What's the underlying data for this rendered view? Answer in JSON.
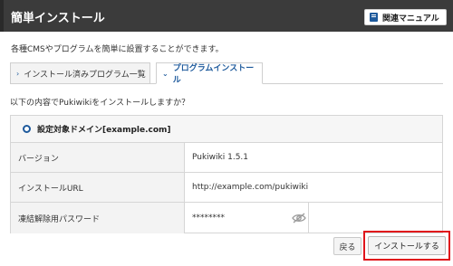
{
  "header": {
    "title": "簡単インストール",
    "manual_label": "関連マニュアル"
  },
  "description": "各種CMSやプログラムを簡単に設置することができます。",
  "tabs": [
    {
      "label": "インストール済みプログラム一覧",
      "active": false
    },
    {
      "label": "プログラムインストール",
      "active": true
    }
  ],
  "question": "以下の内容でPukiwikiをインストールしますか？",
  "panel": {
    "domain_label": "設定対象ドメイン[example.com]",
    "rows": [
      {
        "label": "バージョン",
        "value": "Pukiwiki 1.5.1"
      },
      {
        "label": "インストールURL",
        "value": "http://example.com/pukiwiki"
      },
      {
        "label": "凍結解除用パスワード",
        "value": "********"
      }
    ]
  },
  "buttons": {
    "back": "戻る",
    "install": "インストールする"
  },
  "colors": {
    "header_bg": "#3b3b3b",
    "accent": "#1e5a9c",
    "highlight": "#e0141b"
  }
}
